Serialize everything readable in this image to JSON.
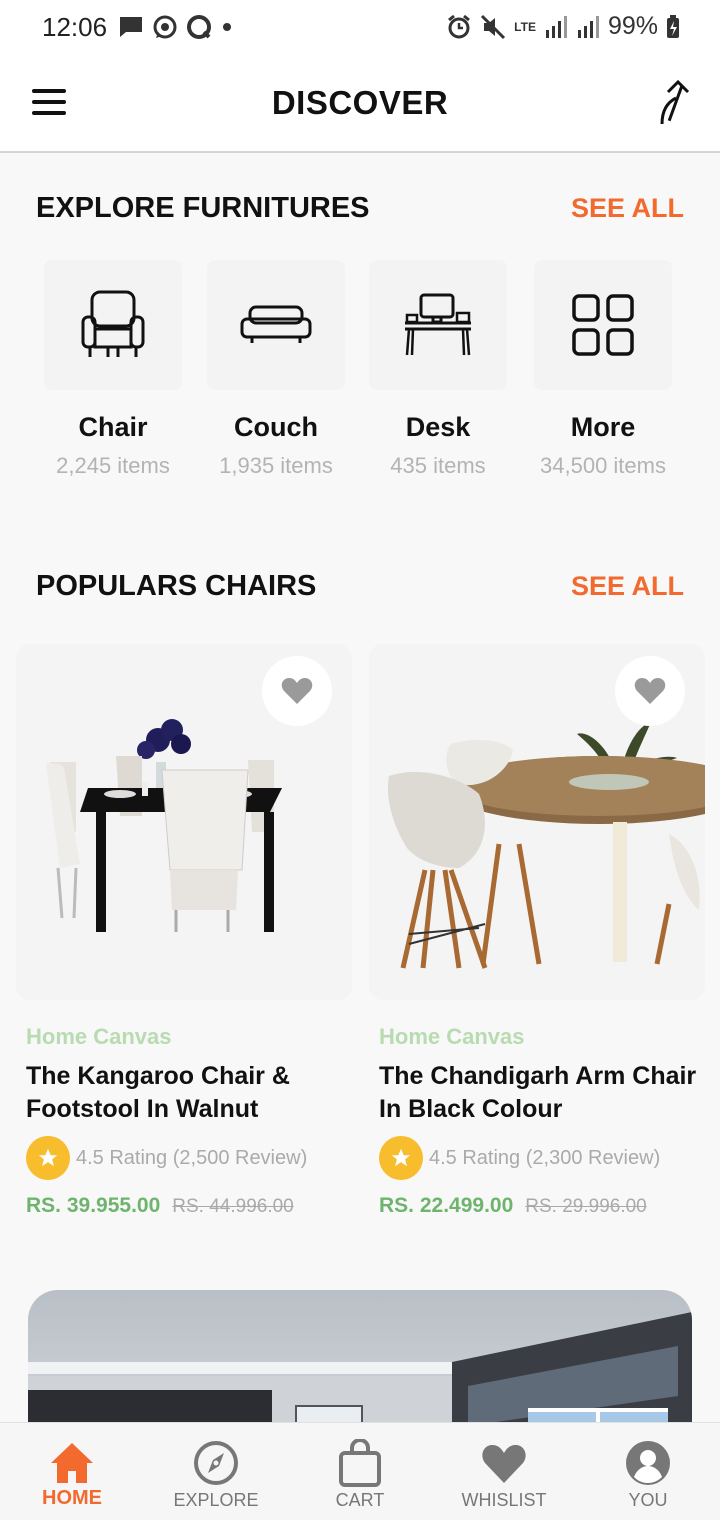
{
  "status_bar": {
    "time": "12:06",
    "network": "LTE",
    "battery": "99%"
  },
  "header": {
    "title": "DISCOVER"
  },
  "explore": {
    "title": "EXPLORE FURNITURES",
    "see_all": "SEE ALL",
    "categories": [
      {
        "name": "Chair",
        "count": "2,245 items",
        "icon": "armchair-icon"
      },
      {
        "name": "Couch",
        "count": "1,935 items",
        "icon": "couch-icon"
      },
      {
        "name": "Desk",
        "count": "435 items",
        "icon": "desk-icon"
      },
      {
        "name": "More",
        "count": "34,500 items",
        "icon": "grid-icon"
      }
    ]
  },
  "popular": {
    "title": "POPULARS CHAIRS",
    "see_all": "SEE ALL",
    "products": [
      {
        "brand": "Home Canvas",
        "name": "The Kangaroo Chair & Footstool In Walnut",
        "rating": "4.5 Rating (2,500 Review)",
        "price": "RS. 39.955.00",
        "old_price": "RS. 44.996.00"
      },
      {
        "brand": "Home Canvas",
        "name": "The Chandigarh Arm Chair In Black Colour",
        "rating": "4.5 Rating (2,300 Review)",
        "price": "RS. 22.499.00",
        "old_price": "RS. 29.996.00"
      }
    ]
  },
  "bottom_nav": {
    "items": [
      {
        "label": "HOME",
        "icon": "home-icon",
        "active": true
      },
      {
        "label": "EXPLORE",
        "icon": "compass-icon"
      },
      {
        "label": "CART",
        "icon": "shopping-bag-icon"
      },
      {
        "label": "WHISLIST",
        "icon": "heart-icon"
      },
      {
        "label": "YOU",
        "icon": "user-icon"
      }
    ]
  },
  "colors": {
    "accent": "#f26a2e",
    "price": "#6fb46d",
    "brand": "#b8dbb0",
    "star": "#f7bd2c"
  }
}
